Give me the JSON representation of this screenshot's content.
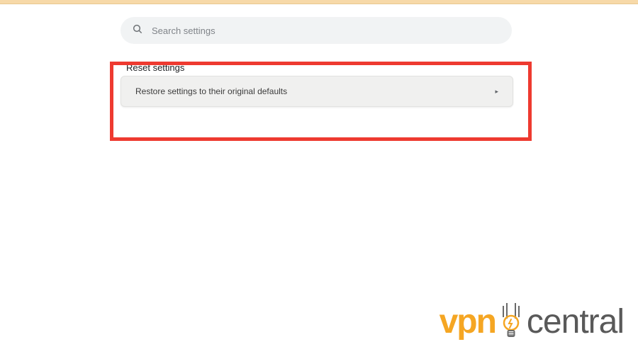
{
  "search": {
    "placeholder": "Search settings"
  },
  "section": {
    "heading": "Reset settings",
    "restore_option": "Restore settings to their original defaults"
  },
  "watermark": {
    "left": "vpn",
    "right": "central"
  },
  "colors": {
    "highlight": "#ee3a30",
    "accent": "#f5a623"
  }
}
